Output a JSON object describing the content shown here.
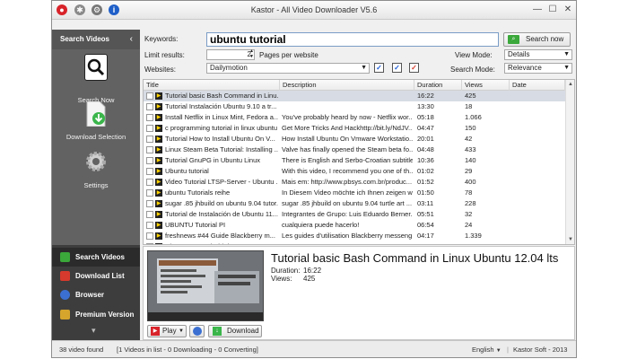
{
  "window": {
    "title": "Kastor - All Video Downloader V5.6",
    "controls": {
      "minimize": "—",
      "maximize": "☐",
      "close": "✕"
    }
  },
  "sidebar": {
    "header": "Search Videos",
    "collapse": "‹",
    "tools": [
      {
        "label": "Search Now",
        "icon": "magnifier-icon"
      },
      {
        "label": "Download Selection",
        "icon": "download-icon"
      },
      {
        "label": "Settings",
        "icon": "gear-icon"
      }
    ],
    "nav": [
      {
        "label": "Search Videos",
        "active": true,
        "color": "#3aa83a"
      },
      {
        "label": "Download List",
        "active": false,
        "color": "#d63a2c"
      },
      {
        "label": "Browser",
        "active": false,
        "color": "#3b6fd1"
      },
      {
        "label": "Premium Version",
        "active": false,
        "color": "#d6a52c"
      }
    ],
    "more": "▾"
  },
  "search": {
    "keywords_label": "Keywords:",
    "keywords_value": "ubuntu tutorial",
    "search_button": "Search now",
    "limit_label": "Limit results:",
    "limit_value": "2",
    "pages_label": "Pages per website",
    "websites_label": "Websites:",
    "website_value": "Dailymotion",
    "view_mode_label": "View Mode:",
    "view_mode_value": "Details",
    "search_mode_label": "Search Mode:",
    "search_mode_value": "Relevance"
  },
  "table": {
    "columns": [
      "Title",
      "Description",
      "Duration",
      "Views",
      "Date"
    ],
    "rows": [
      {
        "title": "Tutorial basic Bash Command in Linu...",
        "desc": "",
        "duration": "16:22",
        "views": "425",
        "selected": true
      },
      {
        "title": "Tutorial Instalación Ubuntu 9.10 a tr...",
        "desc": "",
        "duration": "13:30",
        "views": "18"
      },
      {
        "title": "Install Netflix in Linux Mint, Fedora a...",
        "desc": "You've probably heard by now - Netflix wor...",
        "duration": "05:18",
        "views": "1.066"
      },
      {
        "title": "c programming tutorial in linux ubuntu",
        "desc": "Get More Tricks And Hackhttp://bit.ly/NdJV...",
        "duration": "04:47",
        "views": "150"
      },
      {
        "title": "Tutorial How to Install Ubuntu On V...",
        "desc": "How Install Ubuntu On Vmware Workstatio...",
        "duration": "20:01",
        "views": "42"
      },
      {
        "title": "Linux Steam Beta Tutorial: Installing ...",
        "desc": "Valve has finally opened the Steam beta fo...",
        "duration": "04:48",
        "views": "433"
      },
      {
        "title": "Tutorial GnuPG in Ubuntu Linux",
        "desc": "There is English and Serbo-Croatian subtitle...",
        "duration": "10:36",
        "views": "140"
      },
      {
        "title": "Ubuntu tutorial",
        "desc": "With this video, I recommend you one of th...",
        "duration": "01:02",
        "views": "29"
      },
      {
        "title": "Video Tutorial LTSP-Server - Ubuntu ...",
        "desc": "Mais em: http://www.pbsys.com.br/produc...",
        "duration": "01:52",
        "views": "400"
      },
      {
        "title": "ubuntu Tutorials reihe",
        "desc": "In Diesem Video möchte ich Ihnen zeigen wi...",
        "duration": "01:50",
        "views": "78"
      },
      {
        "title": "sugar .85 jhbuild on ubuntu 9.04 tutor...",
        "desc": "sugar .85 jhbuild on ubuntu 9.04 turtle art ...",
        "duration": "03:11",
        "views": "228"
      },
      {
        "title": "Tutorial de Instalación de Ubuntu 11....",
        "desc": "Integrantes de Grupo: Luis Eduardo Berner...",
        "duration": "05:51",
        "views": "32"
      },
      {
        "title": "UBUNTU Tutorial PI",
        "desc": "cualquiera puede hacerlo!",
        "duration": "06:54",
        "views": "24"
      },
      {
        "title": "freshnews #44 Guide Blackberry m...",
        "desc": "Les guides d'utilisation Blackberry messeng...",
        "duration": "04:17",
        "views": "1.339"
      },
      {
        "title": "Ubuntu For Android demo",
        "desc": "",
        "duration": "",
        "views": ""
      }
    ]
  },
  "detail": {
    "title": "Tutorial basic Bash Command in Linux Ubuntu 12.04 lts",
    "duration_label": "Duration:",
    "duration_value": "16:22",
    "views_label": "Views:",
    "views_value": "425",
    "play_label": "Play",
    "download_label": "Download"
  },
  "status": {
    "found": "38 video found",
    "summary": "[1 Videos in list - 0 Downloading - 0 Converting]",
    "language": "English",
    "company": "Kastor Soft - 2013"
  }
}
